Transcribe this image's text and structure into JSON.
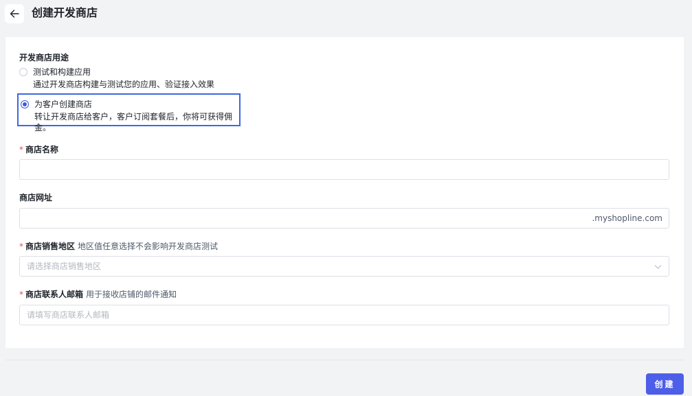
{
  "header": {
    "title": "创建开发商店"
  },
  "purpose": {
    "label": "开发商店用途",
    "options": [
      {
        "title": "测试和构建应用",
        "desc": "通过开发商店构建与测试您的应用、验证接入效果",
        "selected": false
      },
      {
        "title": "为客户创建商店",
        "desc": "转让开发商店给客户，客户订阅套餐后，你将可获得佣金。",
        "selected": true
      }
    ]
  },
  "fields": {
    "store_name": {
      "required": "*",
      "label": "商店名称",
      "value": ""
    },
    "store_url": {
      "label": "商店网址",
      "value": "",
      "suffix": ".myshopline.com"
    },
    "sales_region": {
      "required": "*",
      "label": "商店销售地区",
      "hint": "地区值任意选择不会影响开发商店测试",
      "placeholder": "请选择商店销售地区"
    },
    "contact_email": {
      "required": "*",
      "label": "商店联系人邮箱",
      "hint": "用于接收店铺的邮件通知",
      "placeholder": "请填写商店联系人邮箱"
    }
  },
  "footer": {
    "create_label": "创建"
  },
  "colors": {
    "accent": "#4d5fe8",
    "highlight_border": "#3c68e0",
    "required": "#e34d59"
  }
}
